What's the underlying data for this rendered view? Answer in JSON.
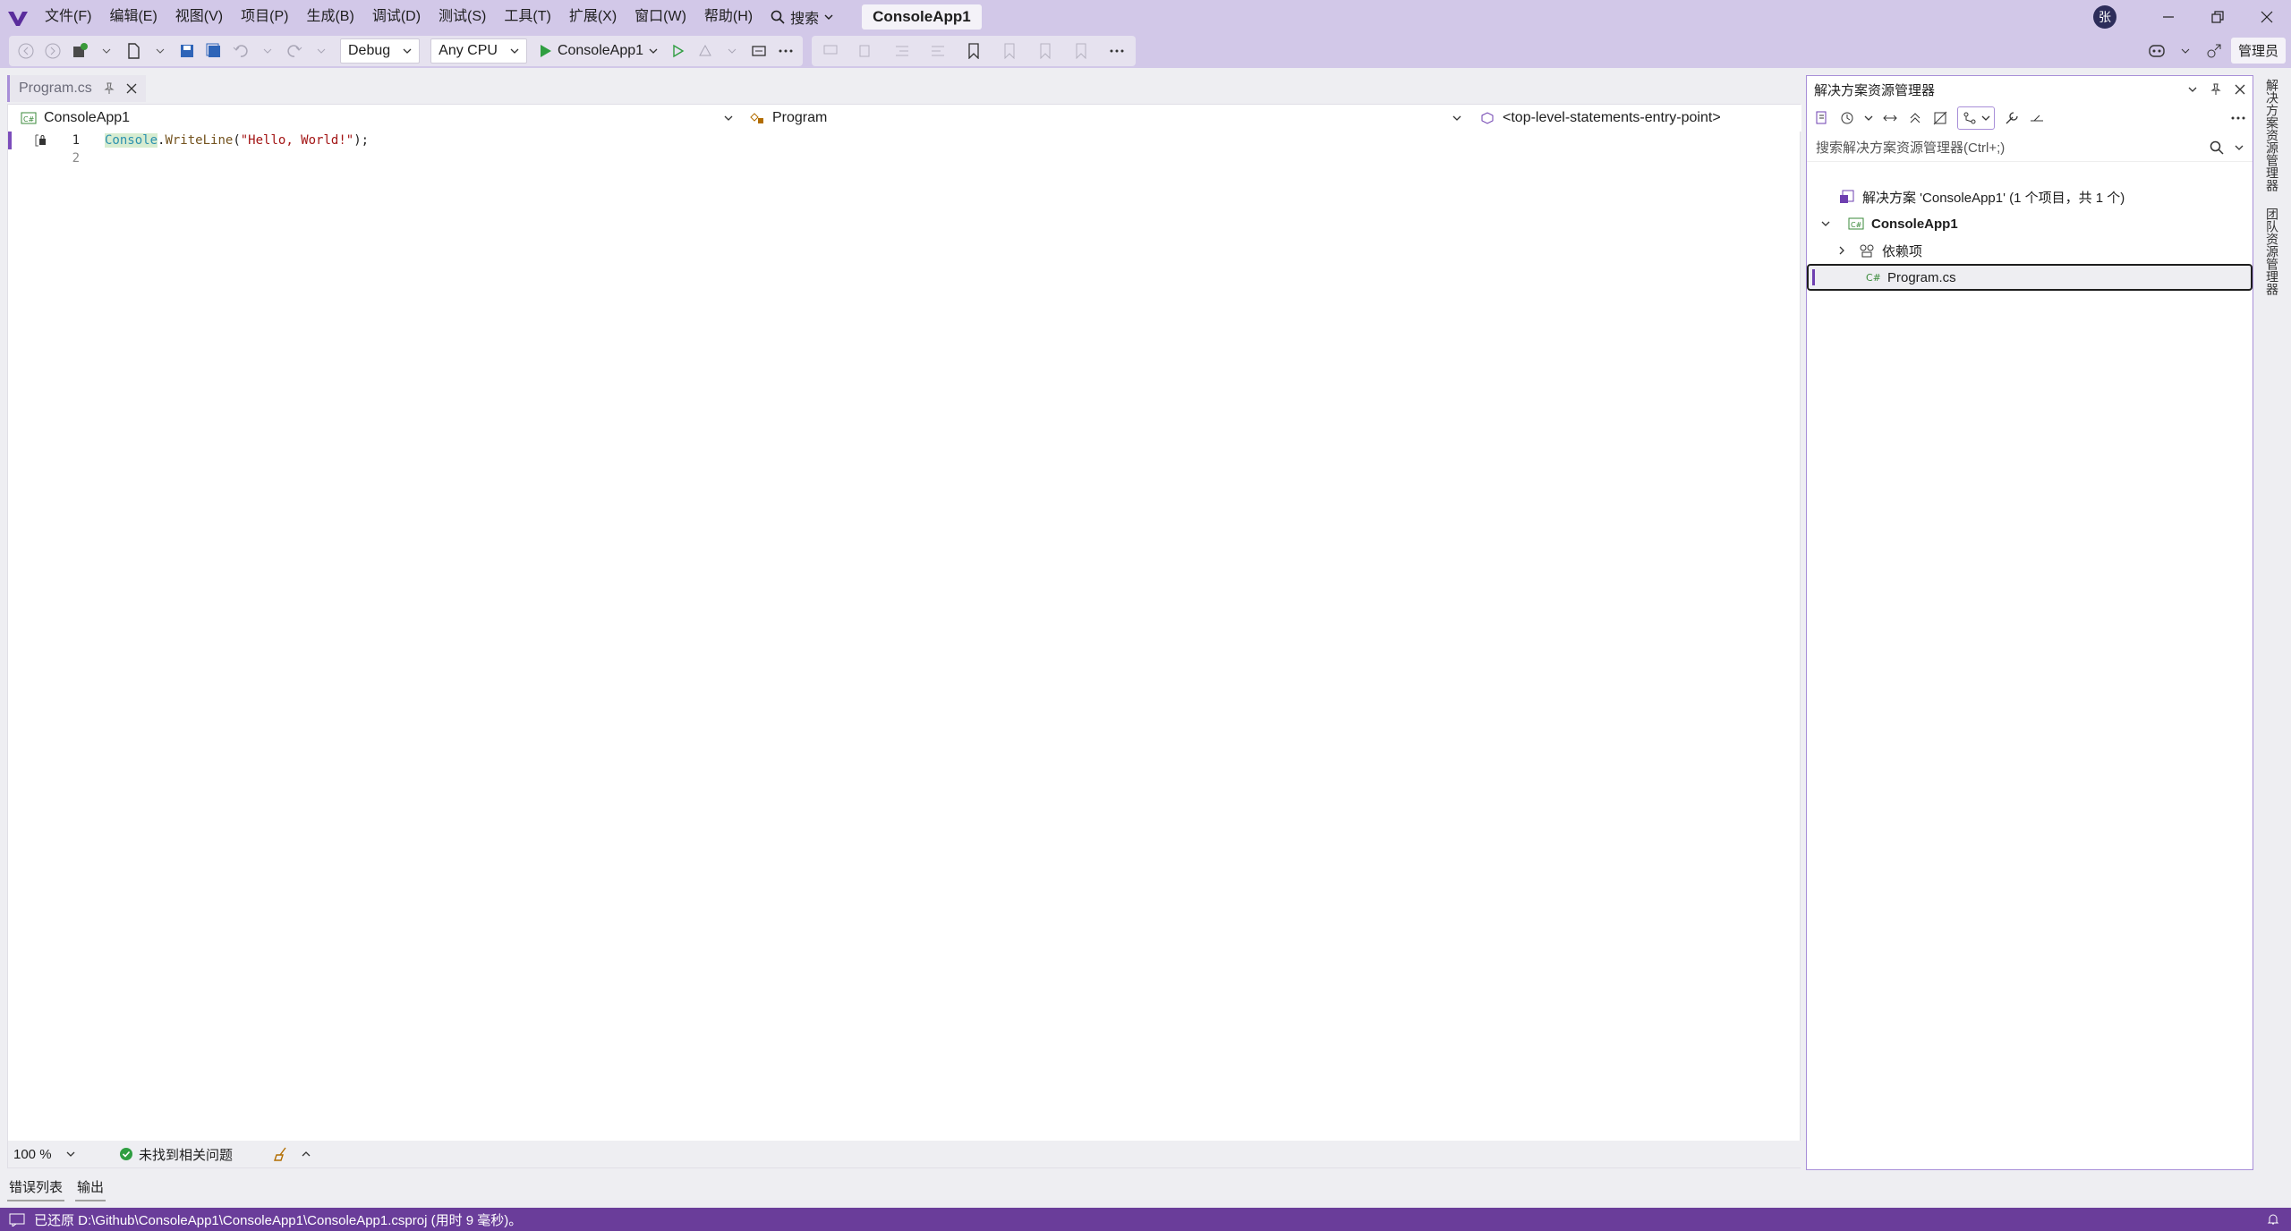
{
  "menu": {
    "items": [
      "文件(F)",
      "编辑(E)",
      "视图(V)",
      "项目(P)",
      "生成(B)",
      "调试(D)",
      "测试(S)",
      "工具(T)",
      "扩展(X)",
      "窗口(W)",
      "帮助(H)"
    ],
    "search_label": "搜索",
    "solution_title": "ConsoleApp1"
  },
  "title_right": {
    "avatar_letter": "张"
  },
  "toolbar": {
    "config": "Debug",
    "platform": "Any CPU",
    "run_label": "ConsoleApp1",
    "admin_label": "管理员"
  },
  "editor": {
    "tab_label": "Program.cs",
    "nav_project": "ConsoleApp1",
    "nav_type": "Program",
    "nav_member": "<top-level-statements-entry-point>",
    "lines": [
      {
        "number": "1",
        "tokens": [
          {
            "text": "Console",
            "kind": "class"
          },
          {
            "text": ".",
            "kind": "punct"
          },
          {
            "text": "WriteLine",
            "kind": "method"
          },
          {
            "text": "(",
            "kind": "punct"
          },
          {
            "text": "\"Hello, World!\"",
            "kind": "string"
          },
          {
            "text": ");",
            "kind": "punct"
          }
        ]
      },
      {
        "number": "2",
        "tokens": []
      }
    ],
    "zoom": "100 %",
    "issues": "未找到相关问题"
  },
  "bottom_tabs": [
    "错误列表",
    "输出"
  ],
  "statusbar": {
    "message": "已还原 D:\\Github\\ConsoleApp1\\ConsoleApp1\\ConsoleApp1.csproj (用时 9 毫秒)。"
  },
  "solution_explorer": {
    "title": "解决方案资源管理器",
    "search_placeholder": "搜索解决方案资源管理器(Ctrl+;)",
    "solution_node": "解决方案 'ConsoleApp1' (1 个项目，共 1 个)",
    "project_node": "ConsoleApp1",
    "deps_node": "依赖项",
    "file_node": "Program.cs"
  },
  "side_rail": [
    "解决方案资源管理器",
    "团队资源管理器"
  ],
  "colors": {
    "accent": "#6a3d9a",
    "titlebar": "#d2c8e8",
    "selection_border": "#a88fd8"
  }
}
